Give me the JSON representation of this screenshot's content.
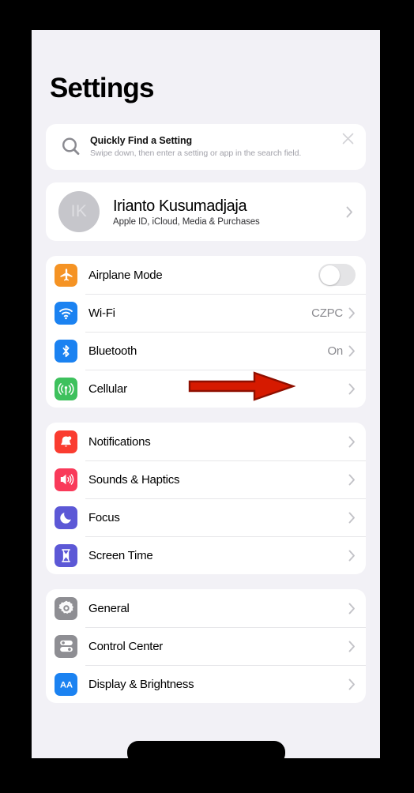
{
  "page": {
    "title": "Settings"
  },
  "search_tip": {
    "icon": "search-icon",
    "title": "Quickly Find a Setting",
    "subtitle": "Swipe down, then enter a setting or app in the search field.",
    "close_icon": "close-icon"
  },
  "account": {
    "avatar_initials": "IK",
    "name": "Irianto Kusumadjaja",
    "subtitle": "Apple ID, iCloud, Media & Purchases",
    "chevron": "chevron-right-icon"
  },
  "groups": [
    {
      "name": "connectivity",
      "rows": [
        {
          "label": "Airplane Mode",
          "icon": "airplane-icon",
          "icon_color": "#f59324",
          "control": "toggle",
          "toggle_on": false,
          "value": "",
          "chevron": false
        },
        {
          "label": "Wi-Fi",
          "icon": "wifi-icon",
          "icon_color": "#1b82f1",
          "control": "value",
          "value": "CZPC",
          "chevron": true
        },
        {
          "label": "Bluetooth",
          "icon": "bluetooth-icon",
          "icon_color": "#1b82f1",
          "control": "value",
          "value": "On",
          "chevron": true
        },
        {
          "label": "Cellular",
          "icon": "cellular-icon",
          "icon_color": "#3ec15d",
          "control": "value",
          "value": "",
          "chevron": true
        }
      ]
    },
    {
      "name": "alerts",
      "rows": [
        {
          "label": "Notifications",
          "icon": "bell-icon",
          "icon_color": "#fa3c30",
          "control": "value",
          "value": "",
          "chevron": true
        },
        {
          "label": "Sounds & Haptics",
          "icon": "speaker-icon",
          "icon_color": "#f93a5a",
          "control": "value",
          "value": "",
          "chevron": true
        },
        {
          "label": "Focus",
          "icon": "moon-icon",
          "icon_color": "#5c58d6",
          "control": "value",
          "value": "",
          "chevron": true
        },
        {
          "label": "Screen Time",
          "icon": "hourglass-icon",
          "icon_color": "#5c58d6",
          "control": "value",
          "value": "",
          "chevron": true
        }
      ]
    },
    {
      "name": "system",
      "rows": [
        {
          "label": "General",
          "icon": "gear-icon",
          "icon_color": "#8e8e93",
          "control": "value",
          "value": "",
          "chevron": true
        },
        {
          "label": "Control Center",
          "icon": "sliders-icon",
          "icon_color": "#8e8e93",
          "control": "value",
          "value": "",
          "chevron": true
        },
        {
          "label": "Display & Brightness",
          "icon": "text-size-icon",
          "icon_color": "#1b82f1",
          "control": "value",
          "value": "",
          "chevron": true
        }
      ]
    }
  ],
  "annotation": {
    "type": "arrow",
    "direction": "right",
    "color": "#d61a00",
    "outline_color": "#8f0f00",
    "points_at": "Bluetooth"
  }
}
